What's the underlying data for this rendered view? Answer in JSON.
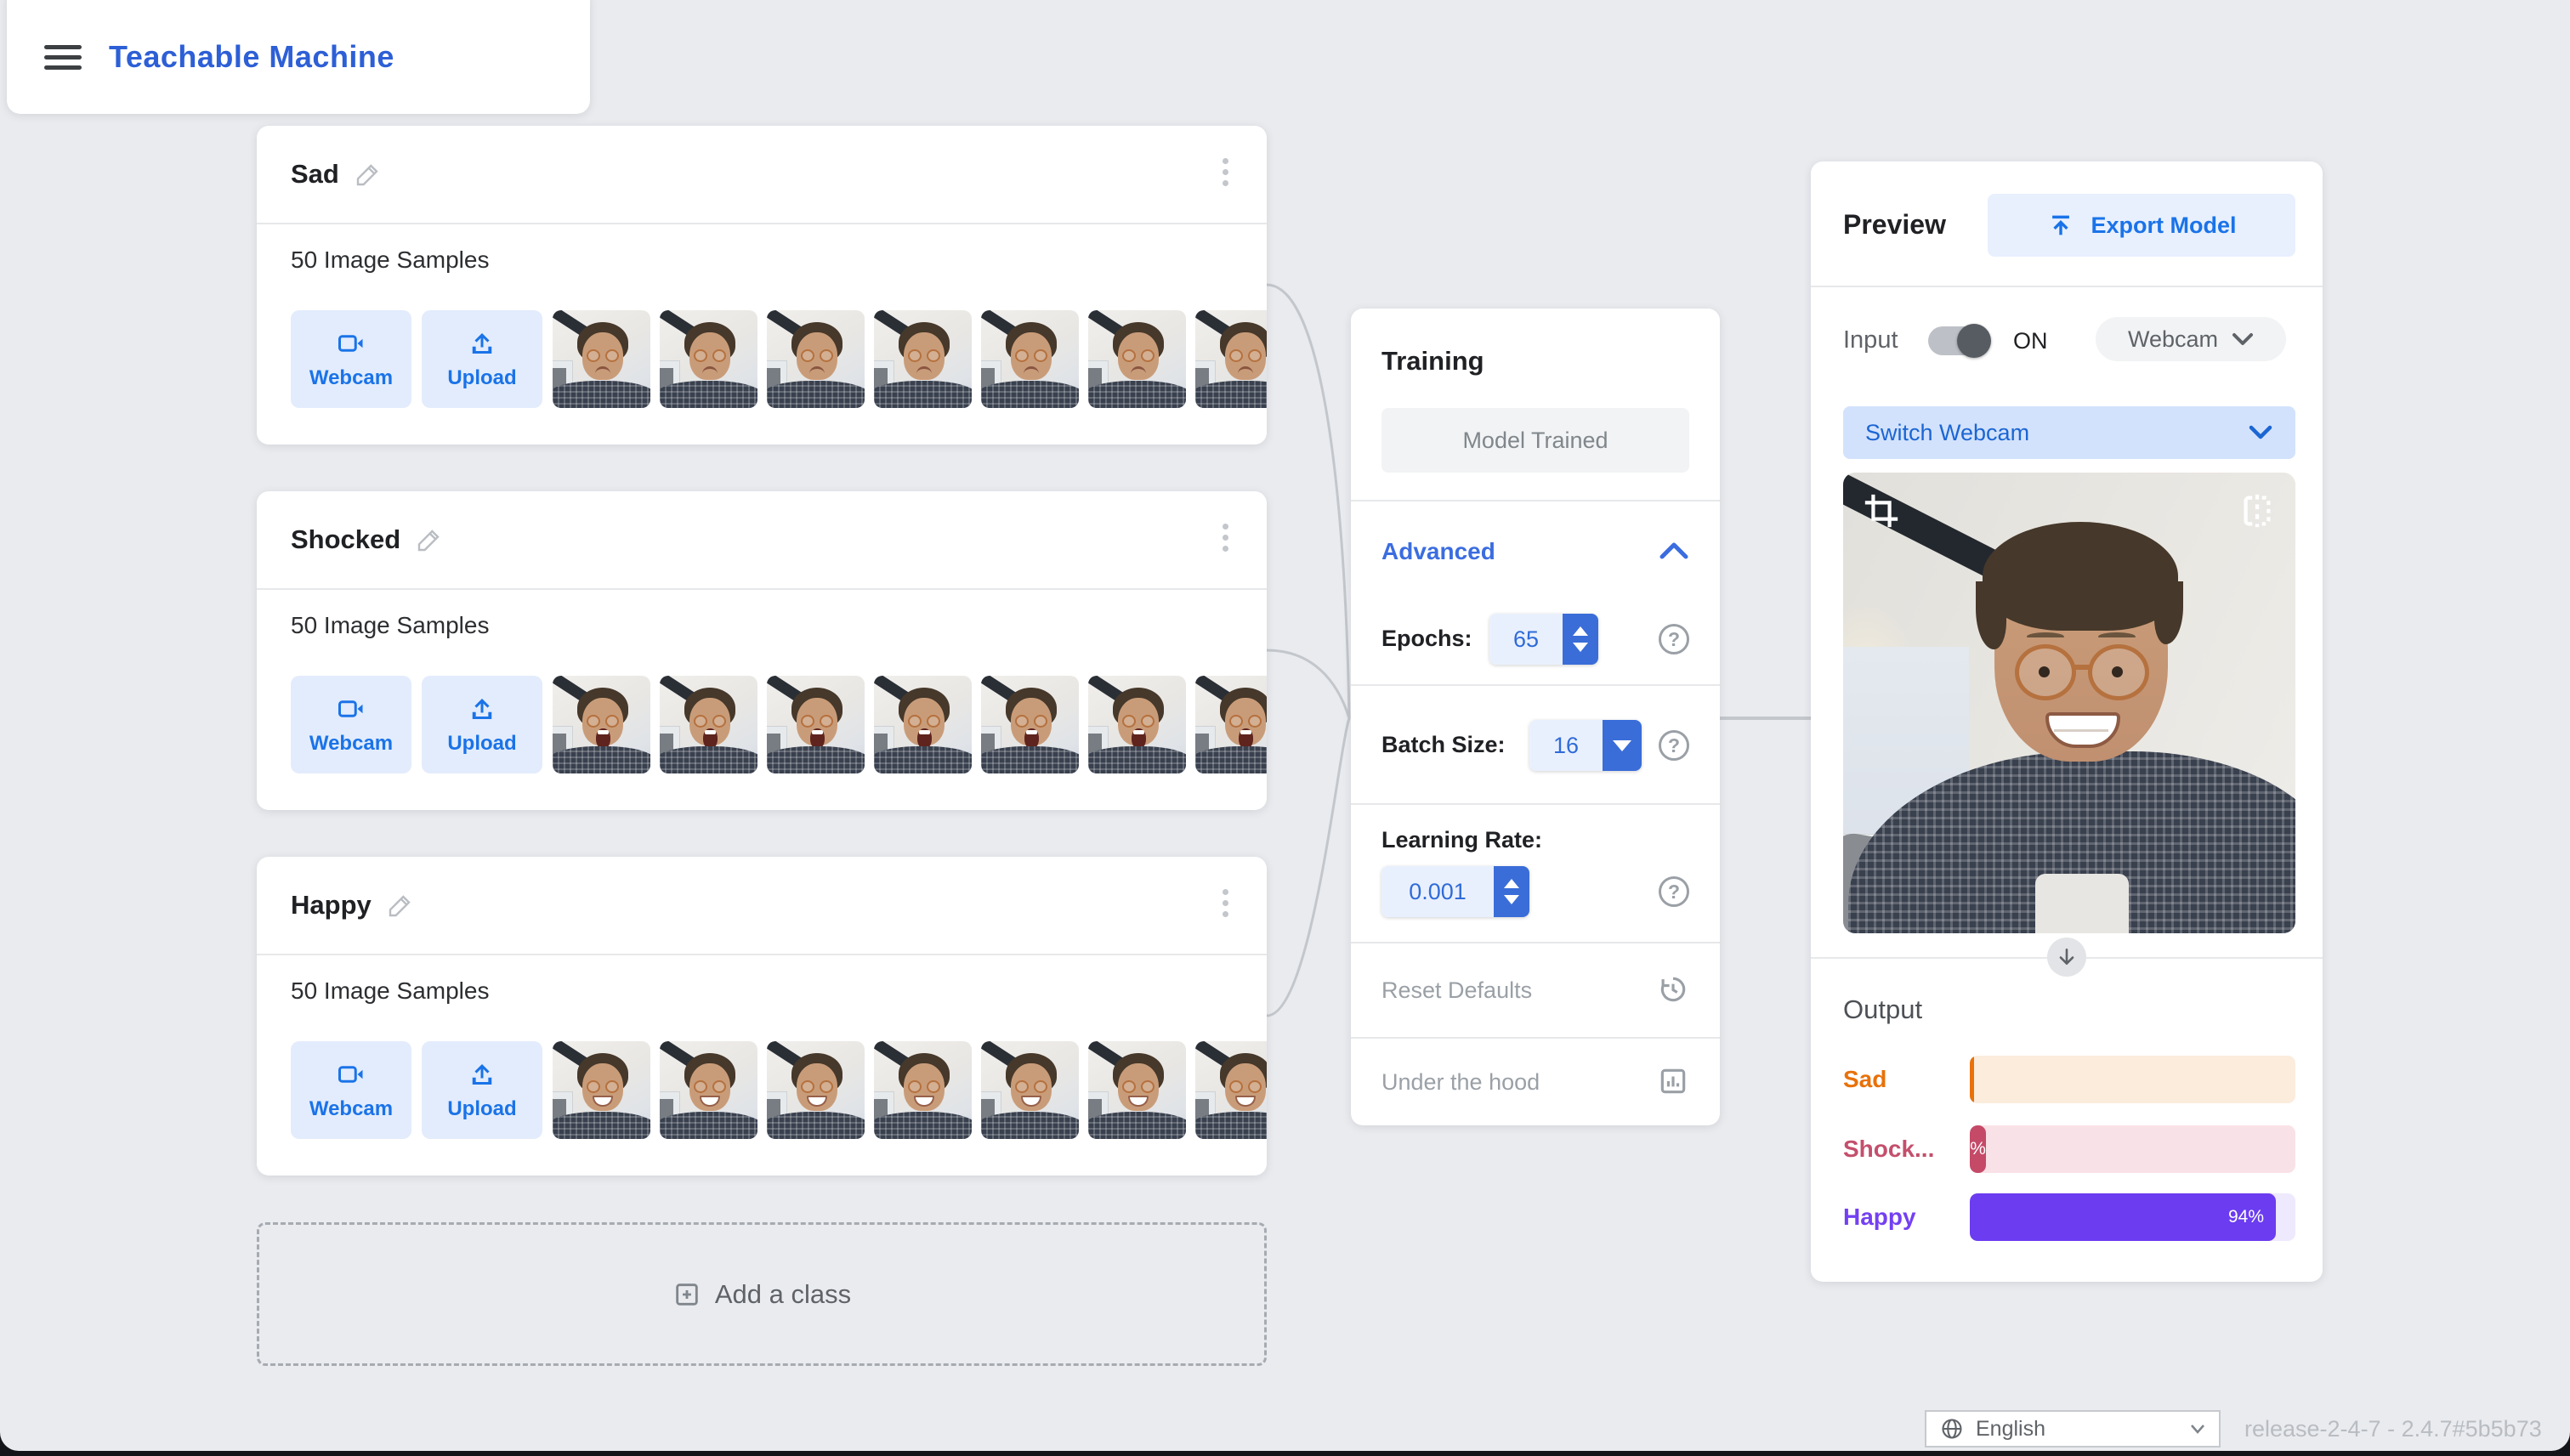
{
  "app": {
    "title": "Teachable Machine"
  },
  "classes": [
    {
      "name": "Sad",
      "samples_label": "50 Image Samples",
      "expression": "sad",
      "thumb_count": 7
    },
    {
      "name": "Shocked",
      "samples_label": "50 Image Samples",
      "expression": "shocked",
      "thumb_count": 7
    },
    {
      "name": "Happy",
      "samples_label": "50 Image Samples",
      "expression": "happy",
      "thumb_count": 7
    }
  ],
  "class_card_labels": {
    "webcam": "Webcam",
    "upload": "Upload"
  },
  "add_class": {
    "label": "Add a class"
  },
  "training": {
    "title": "Training",
    "train_button": "Model Trained",
    "advanced_label": "Advanced",
    "epochs_label": "Epochs:",
    "epochs_value": "65",
    "batch_label": "Batch Size:",
    "batch_value": "16",
    "learning_rate_label": "Learning Rate:",
    "learning_rate_value": "0.001",
    "reset_label": "Reset Defaults",
    "under_hood_label": "Under the hood"
  },
  "preview": {
    "title": "Preview",
    "export_label": "Export Model",
    "input_label": "Input",
    "input_state": "ON",
    "source_label": "Webcam",
    "switch_label": "Switch Webcam",
    "output_title": "Output"
  },
  "output_bars": [
    {
      "label": "Sad",
      "value_pct": 1.2,
      "percent_label": "",
      "label_color": "#e8710a",
      "fill_color": "#e8710a",
      "track_color": "#fbecdc"
    },
    {
      "label": "Shock...",
      "value_pct": 5,
      "percent_label": "%",
      "label_color": "#c44f6c",
      "fill_color": "#c44a68",
      "track_color": "#f9e2e7"
    },
    {
      "label": "Happy",
      "value_pct": 94,
      "percent_label": "94%",
      "label_color": "#7440f2",
      "fill_color": "#6b3cf0",
      "track_color": "#efe9fd"
    }
  ],
  "footer": {
    "language": "English",
    "release": "release-2-4-7 - 2.4.7#5b5b73"
  },
  "colors": {
    "accent_blue": "#1a73e8",
    "logo_blue": "#2d5fd6",
    "page_bg": "#e9ebef",
    "stepper_blue": "#3a6dd8"
  },
  "icons": {
    "menu-icon": "hamburger",
    "edit-pencil-icon": "pencil",
    "kebab-menu-icon": "vertical dots",
    "webcam-icon": "videocam",
    "upload-icon": "arrow-up tray",
    "add-box-icon": "plus in square",
    "chevron-up-icon": "^",
    "chevron-down-icon": "v",
    "help-icon": "? in circle",
    "history-icon": "clock with restore arrow",
    "under-hood-icon": "bar chart in frame",
    "export-icon": "publish arrow",
    "crop-icon": "crop frame",
    "flip-icon": "flip horizontal",
    "arrow-down-icon": "down arrow",
    "globe-icon": "globe"
  }
}
